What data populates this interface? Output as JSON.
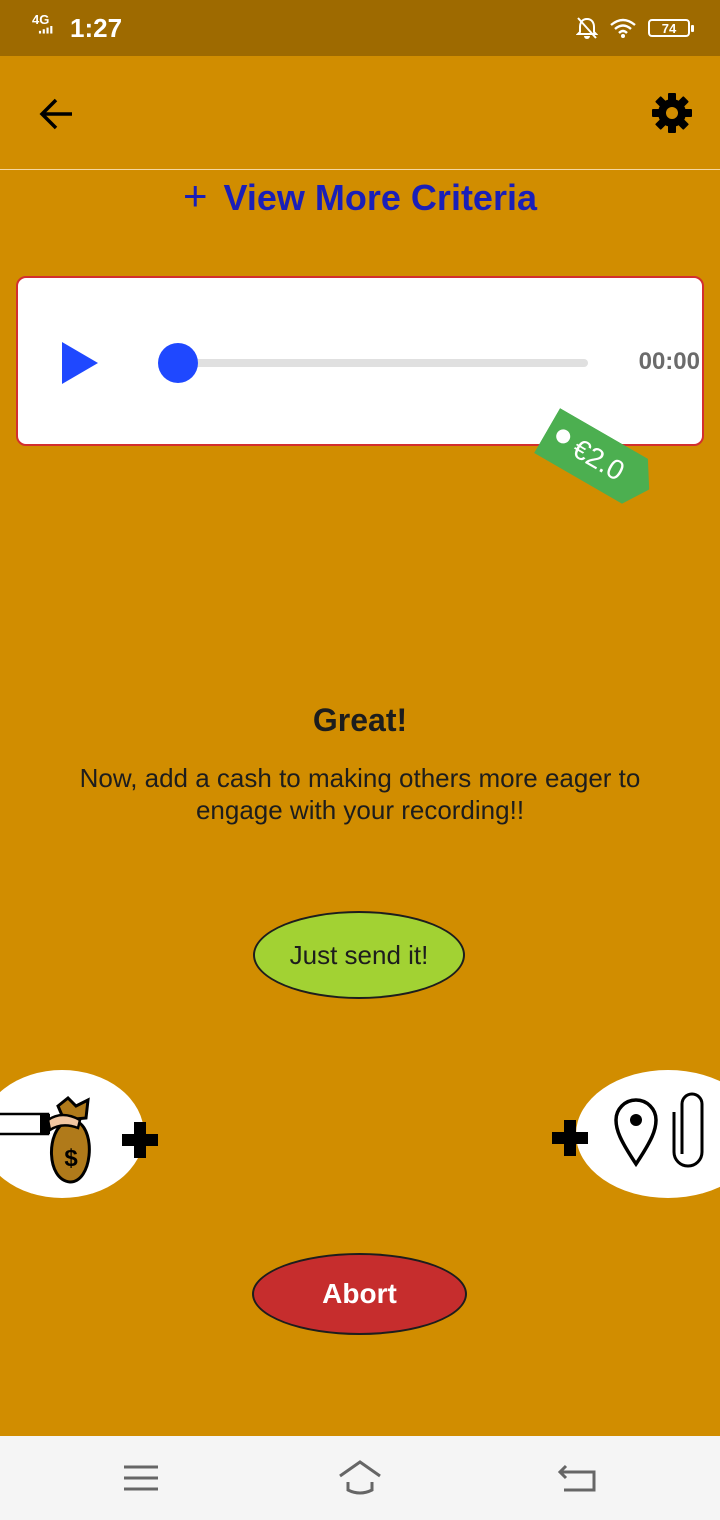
{
  "status_bar": {
    "network": "4G",
    "time": "1:27",
    "battery": "74",
    "icons": [
      "signal-icon",
      "bell-off-icon",
      "wifi-icon",
      "battery-icon"
    ]
  },
  "app_bar": {
    "back_icon": "arrow-left-icon",
    "settings_icon": "gear-icon"
  },
  "criteria": {
    "plus": "+",
    "label": "View More Criteria"
  },
  "player": {
    "time": "00:00",
    "progress": 0,
    "price_tag": "€2.0"
  },
  "prompt": {
    "title": "Great!",
    "message": "Now, add a cash to making others more eager to engage with your recording!!"
  },
  "actions": {
    "send_label": "Just send it!",
    "abort_label": "Abort",
    "cash_icon": "money-bag-icon",
    "attach_icons": [
      "location-pin-icon",
      "paperclip-icon"
    ]
  },
  "colors": {
    "background": "#D18D00",
    "status_bar": "#9E6A00",
    "criteria_text": "#1A1FB8",
    "player_accent": "#1F48FF",
    "tag": "#4CAF50",
    "send_button": "#A2D233",
    "abort_button": "#C62D2D"
  }
}
